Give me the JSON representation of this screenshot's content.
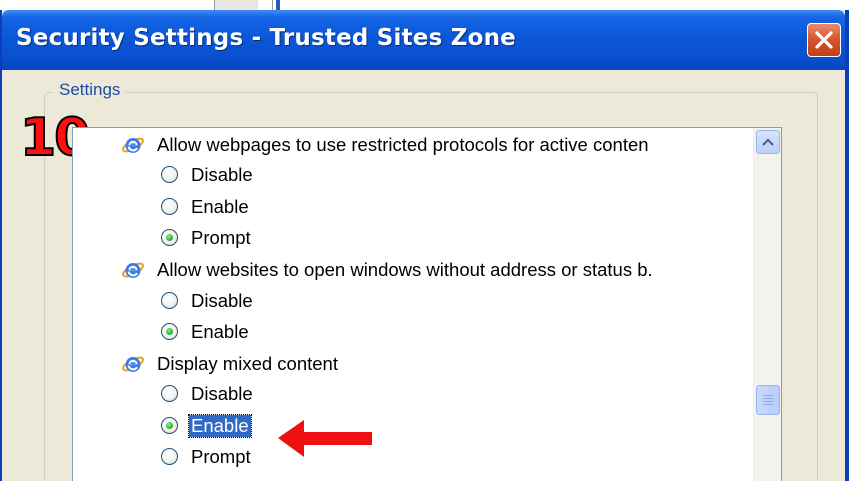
{
  "dialog": {
    "title": "Security Settings - Trusted Sites Zone",
    "group_label": "Settings",
    "step_number": "10"
  },
  "settings": [
    {
      "label": "Allow webpages to use restricted protocols for active conten",
      "icon": "ie-icon",
      "options": [
        {
          "label": "Disable",
          "checked": false
        },
        {
          "label": "Enable",
          "checked": false
        },
        {
          "label": "Prompt",
          "checked": true
        }
      ]
    },
    {
      "label": "Allow websites to open windows without address or status b.",
      "icon": "ie-icon",
      "options": [
        {
          "label": "Disable",
          "checked": false
        },
        {
          "label": "Enable",
          "checked": true
        }
      ]
    },
    {
      "label": "Display mixed content",
      "icon": "ie-icon",
      "options": [
        {
          "label": "Disable",
          "checked": false
        },
        {
          "label": "Enable",
          "checked": true,
          "selected": true
        },
        {
          "label": "Prompt",
          "checked": false
        }
      ]
    }
  ],
  "colors": {
    "title_bar": "#0a4fcf",
    "dialog_bg": "#ece9d8",
    "selection": "#316ac5",
    "annotation": "#ff1010"
  }
}
